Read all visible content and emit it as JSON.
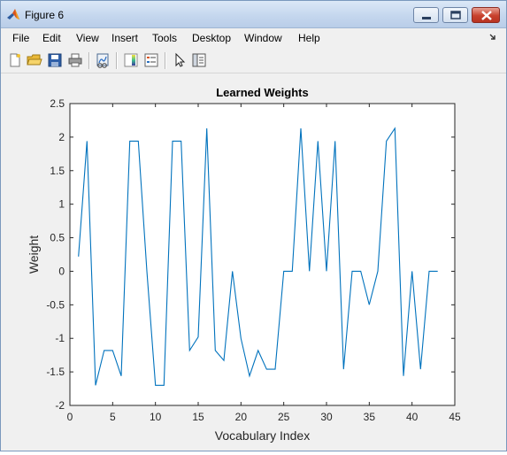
{
  "window": {
    "title": "Figure 6",
    "controls": {
      "minimize_icon": "minimize-icon",
      "maximize_icon": "maximize-icon",
      "close_icon": "close-icon"
    }
  },
  "menubar": {
    "items": [
      {
        "label": "File"
      },
      {
        "label": "Edit"
      },
      {
        "label": "View"
      },
      {
        "label": "Insert"
      },
      {
        "label": "Tools"
      },
      {
        "label": "Desktop"
      },
      {
        "label": "Window"
      },
      {
        "label": "Help"
      }
    ]
  },
  "toolbar": {
    "buttons": [
      {
        "icon": "new-figure-icon"
      },
      {
        "icon": "open-file-icon"
      },
      {
        "icon": "save-figure-icon"
      },
      {
        "icon": "print-figure-icon"
      },
      {
        "icon": "link-plot-icon"
      },
      {
        "icon": "insert-colorbar-icon"
      },
      {
        "icon": "insert-legend-icon"
      },
      {
        "icon": "edit-plot-icon"
      },
      {
        "icon": "show-plot-tools-icon"
      }
    ]
  },
  "chart_data": {
    "type": "line",
    "title": "Learned Weights",
    "xlabel": "Vocabulary Index",
    "ylabel": "Weight",
    "xlim": [
      0,
      45
    ],
    "ylim": [
      -2,
      2.5
    ],
    "xticks": [
      "0",
      "5",
      "10",
      "15",
      "20",
      "25",
      "30",
      "35",
      "40",
      "45"
    ],
    "yticks": [
      "-2",
      "-1.5",
      "-1",
      "-0.5",
      "0",
      "0.5",
      "1",
      "1.5",
      "2",
      "2.5"
    ],
    "grid": false,
    "line_color": "#0072bd",
    "x": [
      1,
      2,
      3,
      4,
      5,
      6,
      7,
      8,
      9,
      10,
      11,
      12,
      13,
      14,
      15,
      16,
      17,
      18,
      19,
      20,
      21,
      22,
      23,
      24,
      25,
      26,
      27,
      28,
      29,
      30,
      31,
      32,
      33,
      34,
      35,
      36,
      37,
      38,
      39,
      40,
      41,
      42,
      43
    ],
    "values": [
      0.22,
      1.94,
      -1.7,
      -1.18,
      -1.18,
      -1.56,
      1.94,
      1.94,
      0.0,
      -1.7,
      -1.7,
      1.94,
      1.94,
      -1.18,
      -0.98,
      2.13,
      -1.18,
      -1.33,
      0.0,
      -1.0,
      -1.56,
      -1.18,
      -1.46,
      -1.46,
      0.0,
      0.0,
      2.13,
      0.0,
      1.94,
      0.0,
      1.94,
      -1.46,
      0.0,
      0.0,
      -0.5,
      0.0,
      1.94,
      2.13,
      -1.56,
      0.0,
      -1.46,
      0.0,
      0.0
    ]
  }
}
